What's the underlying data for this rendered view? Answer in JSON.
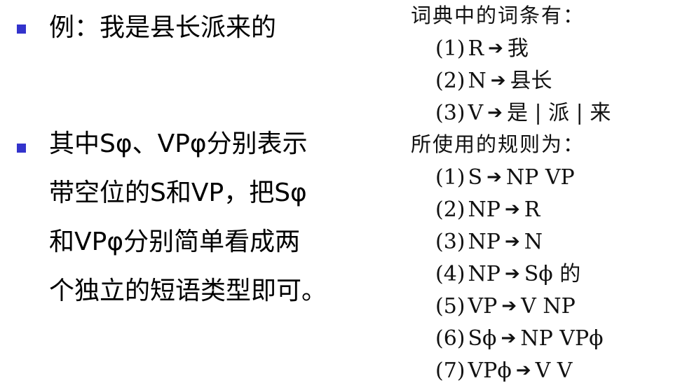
{
  "left": {
    "bullet1": {
      "lines": [
        "例：我是县长派来的"
      ]
    },
    "bullet2": {
      "lines": [
        "其中Sφ、VPφ分别表示",
        "带空位的S和VP，把Sφ",
        "和VPφ分别简单看成两",
        "个独立的短语类型即可。"
      ]
    }
  },
  "dictionary": {
    "heading": "词典中的词条有：",
    "entries": [
      {
        "num": "(1)",
        "lhs": "R",
        "arrow": "➔",
        "rhs": "我"
      },
      {
        "num": "(2)",
        "lhs": "N",
        "arrow": "➔",
        "rhs": "县长"
      },
      {
        "num": "(3)",
        "lhs": "V",
        "arrow": "➔",
        "rhs": "是 | 派 | 来"
      }
    ]
  },
  "rules": {
    "heading": "所使用的规则为：",
    "entries": [
      {
        "num": "(1)",
        "lhs": "S",
        "arrow": "➔",
        "rhs": "NP VP"
      },
      {
        "num": "(2)",
        "lhs": "NP",
        "arrow": "➔",
        "rhs": "R"
      },
      {
        "num": "(3)",
        "lhs": "NP",
        "arrow": "➔",
        "rhs": "N"
      },
      {
        "num": "(4)",
        "lhs": "NP",
        "arrow": "➔",
        "rhs": "Sϕ  的"
      },
      {
        "num": "(5)",
        "lhs": "VP",
        "arrow": "➔",
        "rhs": "V NP"
      },
      {
        "num": "(6)",
        "lhs": "Sϕ",
        "arrow": "➔",
        "rhs": "NP VPϕ"
      },
      {
        "num": "(7)",
        "lhs": "VPϕ",
        "arrow": "➔",
        "rhs": "V V"
      }
    ]
  }
}
